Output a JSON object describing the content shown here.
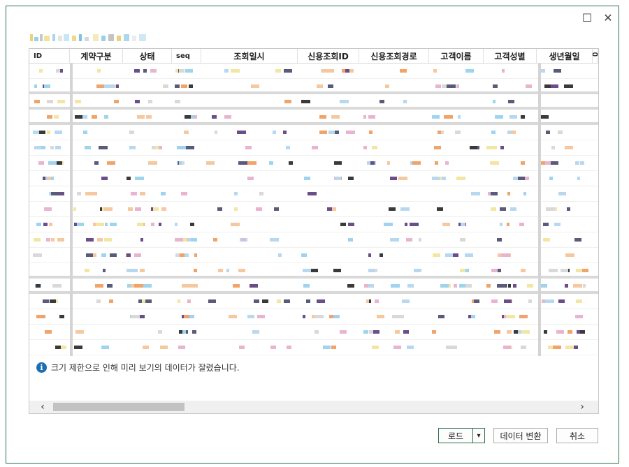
{
  "preview": {
    "columns": [
      {
        "key": "id",
        "label": "ID"
      },
      {
        "key": "contract_type",
        "label": "계약구분"
      },
      {
        "key": "status",
        "label": "상태"
      },
      {
        "key": "seq",
        "label": "seq"
      },
      {
        "key": "query_datetime",
        "label": "조회일시"
      },
      {
        "key": "credit_query_id",
        "label": "신용조회ID"
      },
      {
        "key": "credit_query_path",
        "label": "신용조회경로"
      },
      {
        "key": "customer_name",
        "label": "고객이름"
      },
      {
        "key": "customer_gender",
        "label": "고객성별"
      },
      {
        "key": "birth_date",
        "label": "생년월일"
      },
      {
        "key": "next_col",
        "label": "ᄋ"
      }
    ],
    "info_message": "크기 제한으로 인해 미리 보기의 데이터가 잘렸습니다."
  },
  "icons": {
    "info": "info-icon",
    "maximize": "maximize-icon",
    "close": "close-icon",
    "scroll_left": "chevron-left-icon",
    "scroll_right": "chevron-right-icon",
    "dropdown": "caret-down-icon"
  },
  "glyphs": {
    "maximize": "☐",
    "close": "✕",
    "scroll_left": "‹",
    "scroll_right": "›",
    "dropdown": "▾",
    "info": "i"
  },
  "buttons": {
    "load": "로드",
    "transform": "데이터 변환",
    "cancel": "취소"
  },
  "colors": {
    "accent": "#2f6e4c",
    "info_blue": "#1a6fb3"
  }
}
